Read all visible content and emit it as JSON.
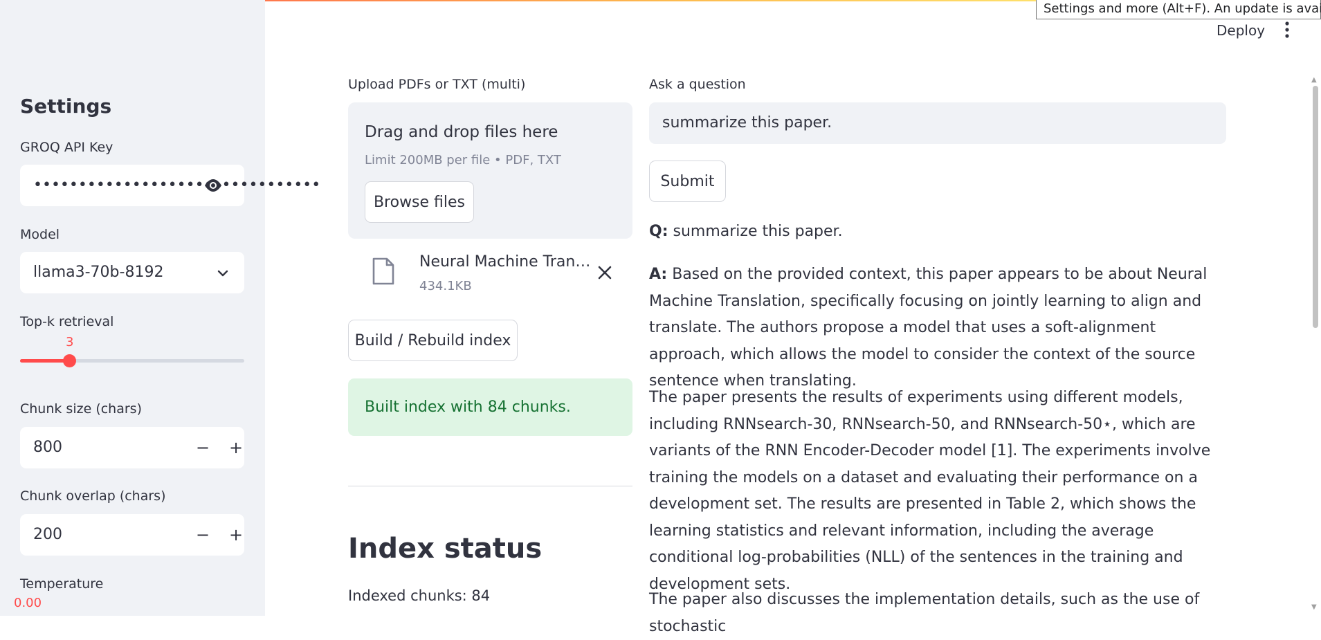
{
  "header": {
    "deploy_label": "Deploy",
    "tooltip": "Settings and more (Alt+F). An update is available."
  },
  "sidebar": {
    "title": "Settings",
    "api_key_label": "GROQ API Key",
    "api_key_value": "••••••••••••••••••••••••••••••••",
    "model_label": "Model",
    "model_value": "llama3-70b-8192",
    "topk_label": "Top-k retrieval",
    "topk_value": "3",
    "topk_fraction": 0.22,
    "chunk_size_label": "Chunk size (chars)",
    "chunk_size_value": "800",
    "chunk_overlap_label": "Chunk overlap (chars)",
    "chunk_overlap_value": "200",
    "temperature_label": "Temperature",
    "temperature_value": "0.00",
    "minus": "−",
    "plus": "+"
  },
  "upload": {
    "label": "Upload PDFs or TXT (multi)",
    "drop_title": "Drag and drop files here",
    "drop_sub": "Limit 200MB per file • PDF, TXT",
    "browse_label": "Browse files",
    "file_name": "Neural Machine Translation by Jointly Learning to Align and Translate.pdf",
    "file_size": "434.1KB"
  },
  "index": {
    "build_label": "Build / Rebuild index",
    "success_msg": "Built index with 84 chunks.",
    "status_heading": "Index status",
    "indexed_chunks": "Indexed chunks: 84"
  },
  "qa": {
    "ask_label": "Ask a question",
    "question_value": "summarize this paper.",
    "submit_label": "Submit",
    "q_prefix": "Q:",
    "q_text": " summarize this paper.",
    "a_prefix": "A:",
    "a_text": " Based on the provided context, this paper appears to be about Neural Machine Translation, specifically focusing on jointly learning to align and translate. The authors propose a model that uses a soft-alignment approach, which allows the model to consider the context of the source sentence when translating.",
    "para2": "The paper presents the results of experiments using different models, including RNNsearch-30, RNNsearch-50, and RNNsearch-50⋆, which are variants of the RNN Encoder-Decoder model [1]. The experiments involve training the models on a dataset and evaluating their performance on a development set. The results are presented in Table 2, which shows the learning statistics and relevant information, including the average conditional log-probabilities (NLL) of the sentences in the training and development sets.",
    "para3": "The paper also discusses the implementation details, such as the use of stochastic"
  }
}
